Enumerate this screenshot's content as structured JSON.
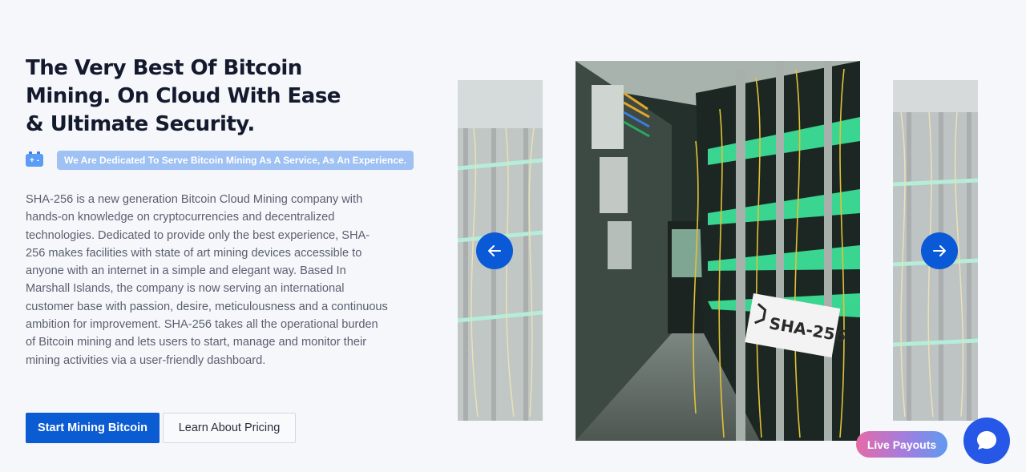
{
  "hero": {
    "title": "The Very Best Of Bitcoin Mining. On Cloud With Ease & Ultimate Security.",
    "tagline": "We Are Dedicated To Serve Bitcoin Mining As A Service, As An Experience.",
    "tagline_icon": "battery-icon",
    "description": "SHA-256 is a new generation Bitcoin Cloud Mining company with hands-on knowledge on cryptocurrencies and decentralized technologies. Dedicated to provide only the best experience, SHA-256 makes facilities with state of art mining devices accessible to anyone with an internet in a simple and elegant way. Based In Marshall Islands, the company is now serving an international customer base with passion, desire, meticulousness and a continuous ambition for improvement. SHA-256 takes all the operational burden of Bitcoin mining and lets users to start, manage and monitor their mining activities via a user-friendly dashboard.",
    "primary_button": "Start Mining Bitcoin",
    "secondary_button": "Learn About Pricing"
  },
  "carousel": {
    "sign_text": "SHA-256",
    "prev_icon": "arrow-left-icon",
    "next_icon": "arrow-right-icon"
  },
  "widgets": {
    "live_payouts": "Live Payouts",
    "chat_icon": "chat-bubble-icon"
  },
  "colors": {
    "accent": "#0b5bd3",
    "background": "#f6f7fa",
    "heading": "#141a2e",
    "body_text": "#5a6072",
    "tagline_badge": "#9fc1f3",
    "chat": "#2657e6"
  }
}
